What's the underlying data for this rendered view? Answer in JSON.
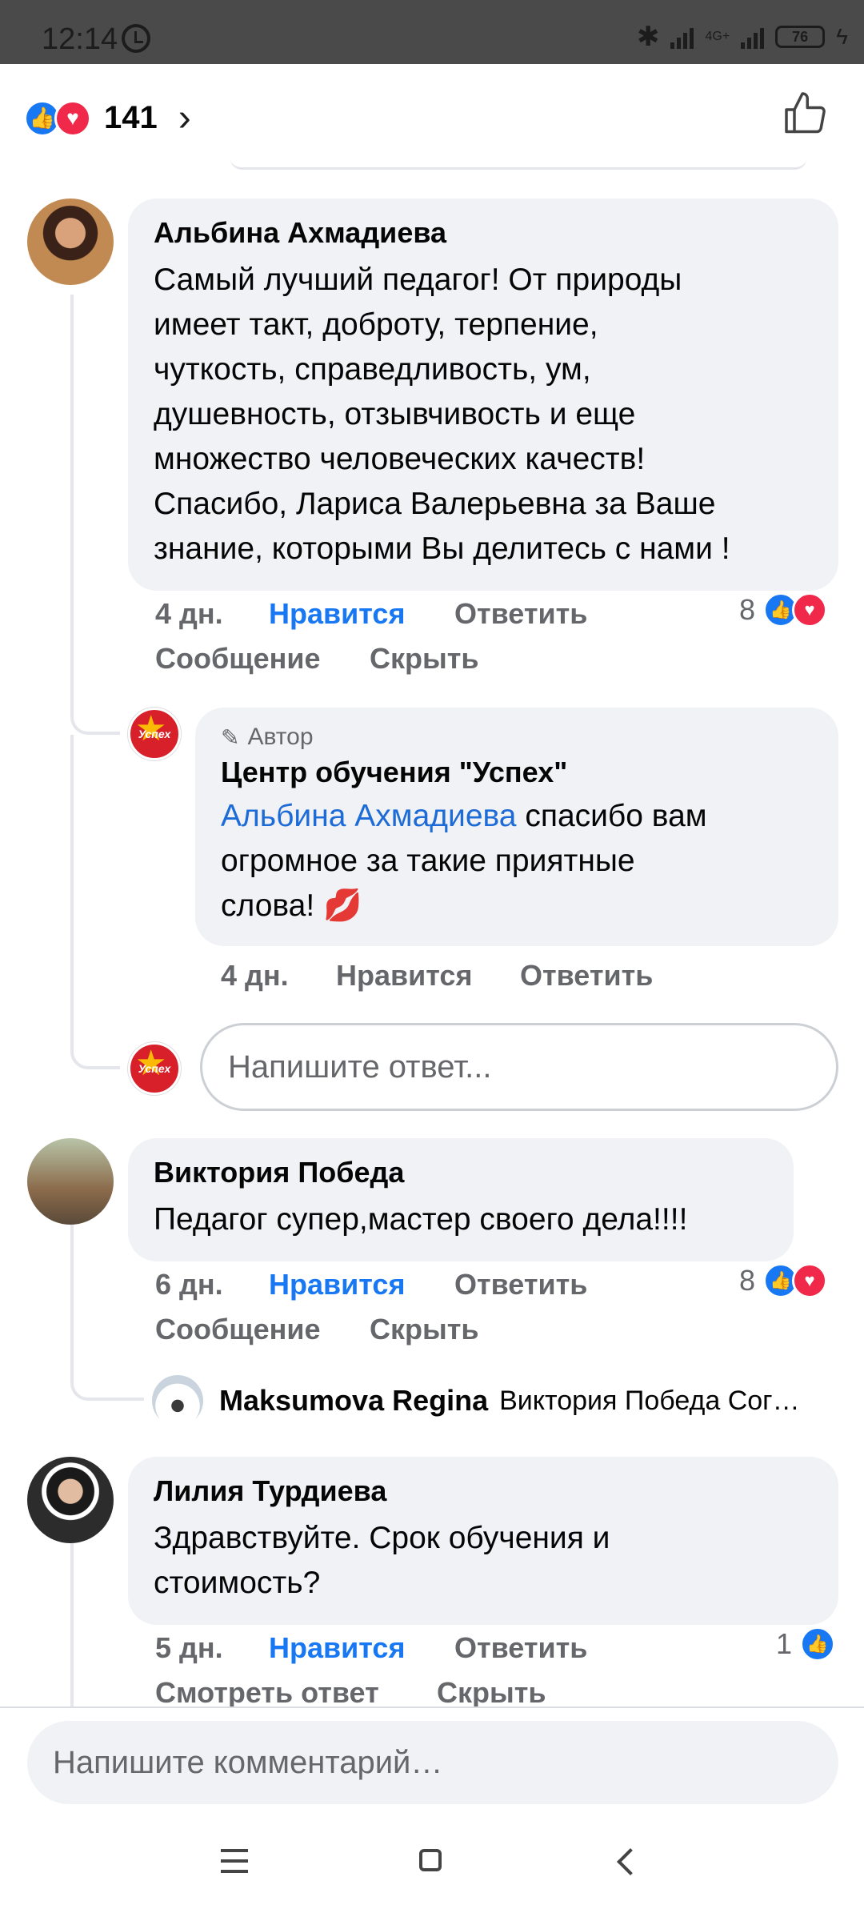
{
  "status_bar": {
    "time": "12:14",
    "network": "4G+",
    "battery": "76"
  },
  "header": {
    "reaction_count": "141"
  },
  "comments": [
    {
      "name": "Альбина Ахмадиева",
      "lines": [
        "Самый лучший педагог! От природы",
        "имеет  такт, доброту, терпение,",
        "чуткость, справедливость, ум,",
        "душевность, отзывчивость и еще",
        "множество человеческих качеств!",
        "Спасибо, Лариса Валерьевна  за Ваше",
        "знание, которыми Вы делитесь с нами !"
      ],
      "time": "4 дн.",
      "like": "Нравится",
      "reply": "Ответить",
      "message": "Сообщение",
      "hide": "Скрыть",
      "reactions": "8"
    },
    {
      "name": "Виктория Победа",
      "lines": [
        "Педагог супер,мастер своего дела!!!!"
      ],
      "time": "6 дн.",
      "like": "Нравится",
      "reply": "Ответить",
      "message": "Сообщение",
      "hide": "Скрыть",
      "reactions": "8"
    },
    {
      "name": "Лилия Турдиева",
      "lines": [
        "Здравствуйте. Срок обучения и",
        "стоимость?"
      ],
      "time": "5 дн.",
      "like": "Нравится",
      "reply": "Ответить",
      "see_reply": "Смотреть ответ",
      "hide": "Скрыть",
      "reactions": "1"
    }
  ],
  "author_reply": {
    "tag": "Автор",
    "name": "Центр обучения \"Успех\"",
    "mention": "Альбина Ахмадиева",
    "line1_rest": " спасибо вам",
    "line2": "огромное за такие приятные",
    "line3": "слова! 💋",
    "time": "4 дн.",
    "like": "Нравится",
    "reply": "Ответить",
    "avatar_text": "Успех"
  },
  "reply_input": {
    "placeholder": "Напишите ответ..."
  },
  "inline_reply": {
    "name": "Maksumova Regina",
    "text": "Виктория Победа Сог…"
  },
  "comment_input": {
    "placeholder": "Напишите комментарий…"
  }
}
